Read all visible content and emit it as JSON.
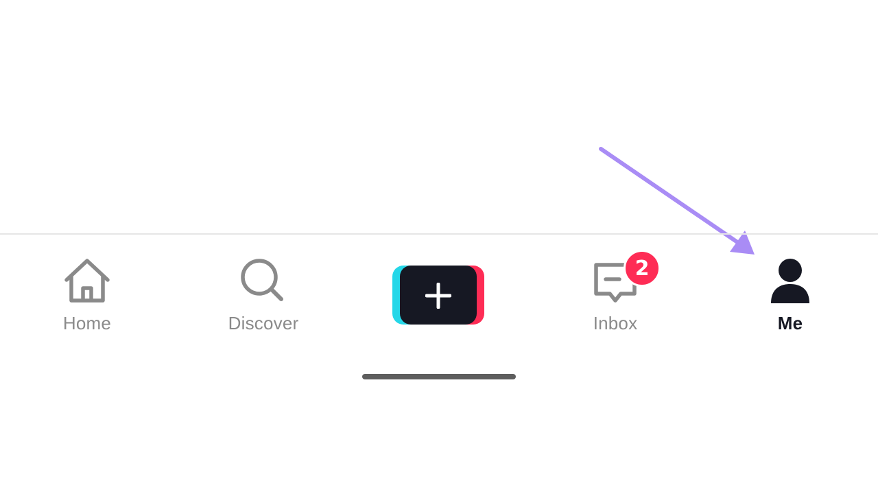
{
  "nav": {
    "home_label": "Home",
    "discover_label": "Discover",
    "inbox_label": "Inbox",
    "me_label": "Me",
    "inbox_badge": "2",
    "active_tab": "Me"
  },
  "icons": {
    "home": "home-icon",
    "discover": "search-icon",
    "create": "plus-icon",
    "inbox": "message-icon",
    "me": "user-icon"
  },
  "colors": {
    "active": "#161823",
    "inactive": "#8a8a8a",
    "badge": "#fe2c55",
    "create_cyan": "#25d7e8",
    "create_red": "#fe2c55",
    "annotation_arrow": "#a98cf5"
  }
}
